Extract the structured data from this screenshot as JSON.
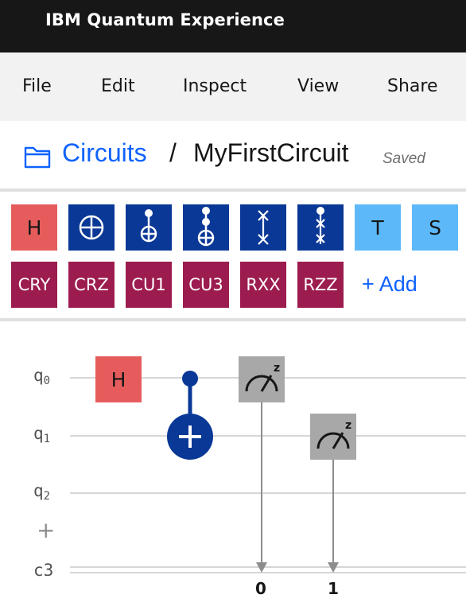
{
  "app": {
    "title": "IBM Quantum Experience"
  },
  "menu": {
    "items": [
      "File",
      "Edit",
      "Inspect",
      "View",
      "Share"
    ]
  },
  "breadcrumb": {
    "parent": "Circuits",
    "separator": "/",
    "current": "MyFirstCircuit",
    "status": "Saved"
  },
  "palette": {
    "row1": [
      {
        "label": "H",
        "kind": "h"
      },
      {
        "label": "",
        "kind": "cnot-icon"
      },
      {
        "label": "",
        "kind": "toffoli-icon"
      },
      {
        "label": "",
        "kind": "ccx-icon"
      },
      {
        "label": "",
        "kind": "swap-icon"
      },
      {
        "label": "",
        "kind": "cswap-icon"
      },
      {
        "label": "T",
        "kind": "t"
      },
      {
        "label": "S",
        "kind": "s"
      }
    ],
    "row2": [
      "CRY",
      "CRZ",
      "CU1",
      "CU3",
      "RXX",
      "RZZ"
    ],
    "add_label": "+ Add"
  },
  "circuit": {
    "wires": [
      {
        "prefix": "q",
        "index": "0"
      },
      {
        "prefix": "q",
        "index": "1"
      },
      {
        "prefix": "q",
        "index": "2"
      }
    ],
    "add_wire_label": "+",
    "classical": "c3",
    "placed_h_label": "H",
    "measure_basis": "z",
    "classical_bits": [
      "0",
      "1"
    ]
  },
  "colors": {
    "h_gate": "#e65c5c",
    "blue_gate": "#0a3896",
    "light_gate": "#5cb8f9",
    "maroon_gate": "#9c1c4f",
    "measure_gate": "#a8a8a8",
    "link": "#0f62fe"
  }
}
